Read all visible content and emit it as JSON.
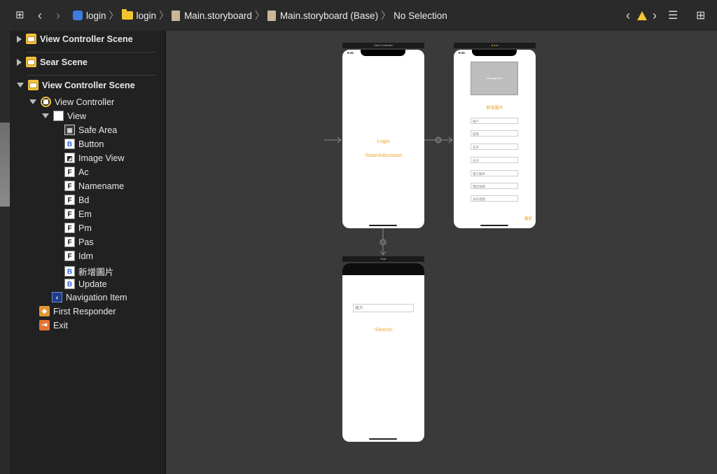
{
  "toolbar": {
    "breadcrumb": [
      "login",
      "login",
      "Main.storyboard",
      "Main.storyboard (Base)",
      "No Selection"
    ]
  },
  "outline": {
    "scenes": [
      {
        "label": "View Controller Scene"
      },
      {
        "label": "Sear Scene"
      },
      {
        "label": "View Controller Scene"
      }
    ],
    "view_controller": "View Controller",
    "view": "View",
    "children": [
      {
        "label": "Safe Area",
        "icon": "safe-area-icon",
        "glyph": "▣"
      },
      {
        "label": "Button",
        "icon": "button-icon",
        "glyph": "B"
      },
      {
        "label": "Image View",
        "icon": "image-view-icon",
        "glyph": "◩"
      },
      {
        "label": "Ac",
        "icon": "text-field-icon",
        "glyph": "F"
      },
      {
        "label": "Namename",
        "icon": "text-field-icon",
        "glyph": "F"
      },
      {
        "label": "Bd",
        "icon": "text-field-icon",
        "glyph": "F"
      },
      {
        "label": "Em",
        "icon": "text-field-icon",
        "glyph": "F"
      },
      {
        "label": "Pm",
        "icon": "text-field-icon",
        "glyph": "F"
      },
      {
        "label": "Pas",
        "icon": "text-field-icon",
        "glyph": "F"
      },
      {
        "label": "Idm",
        "icon": "text-field-icon",
        "glyph": "F"
      },
      {
        "label": "新增圖片",
        "icon": "button-icon",
        "glyph": "B"
      },
      {
        "label": "Update",
        "icon": "button-icon",
        "glyph": "B"
      }
    ],
    "navigation_item": "Navigation Item",
    "first_responder": "First Responder",
    "exit": "Exit"
  },
  "canvas": {
    "login_scene": {
      "title": "View Controller",
      "time": "9:41",
      "login": "Login",
      "search_account": "-SearchAccount-"
    },
    "register_scene": {
      "time": "9:41",
      "image_label": "UIImageView",
      "add_image": "新增圖片",
      "fields": [
        "帳戶",
        "密碼",
        "名字",
        "生日",
        "電子郵件",
        "電話號碼",
        "身份證號"
      ],
      "confirm": "確認"
    },
    "sear_scene": {
      "title": "Sear",
      "field": "帳戶",
      "search": "-Search-"
    }
  },
  "colors": {
    "accent": "#f0a020",
    "scene_icon": "#f4c13d",
    "warning": "#f6c433"
  }
}
